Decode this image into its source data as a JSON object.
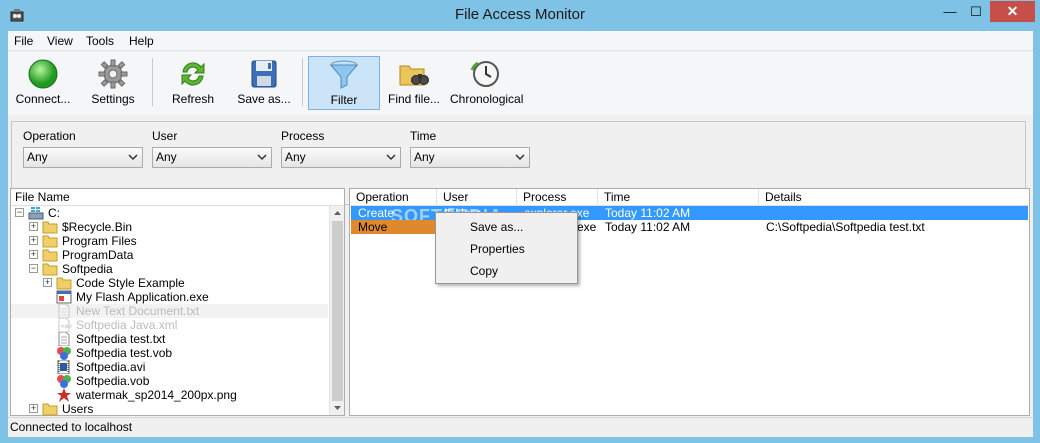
{
  "window": {
    "title": "File Access Monitor",
    "min_glyph": "—",
    "max_glyph": "☐",
    "close_glyph": "✕"
  },
  "menu": [
    "File",
    "View",
    "Tools",
    "Help"
  ],
  "toolbar": {
    "connect": "Connect...",
    "settings": "Settings",
    "refresh": "Refresh",
    "save_as": "Save as...",
    "filter": "Filter",
    "find_file": "Find file...",
    "chronological": "Chronological"
  },
  "filters": [
    {
      "label": "Operation",
      "value": "Any"
    },
    {
      "label": "User",
      "value": "Any"
    },
    {
      "label": "Process",
      "value": "Any"
    },
    {
      "label": "Time",
      "value": "Any"
    }
  ],
  "tree": {
    "header": "File Name",
    "nodes": [
      {
        "label": "C:",
        "icon": "drive-icon",
        "expander": "−"
      },
      {
        "label": "$Recycle.Bin",
        "icon": "folder-icon",
        "expander": "+"
      },
      {
        "label": "Program Files",
        "icon": "folder-icon",
        "expander": "+"
      },
      {
        "label": "ProgramData",
        "icon": "folder-icon",
        "expander": "+"
      },
      {
        "label": "Softpedia",
        "icon": "folder-icon",
        "expander": "−"
      },
      {
        "label": "Code Style Example",
        "icon": "folder-icon",
        "expander": "+"
      },
      {
        "label": "My Flash Application.exe",
        "icon": "exe-icon"
      },
      {
        "label": "New Text Document.txt",
        "icon": "text-file-icon",
        "dim": true
      },
      {
        "label": "Softpedia Java.xml",
        "icon": "xml-file-icon",
        "dim": true
      },
      {
        "label": "Softpedia test.txt",
        "icon": "text-file-icon"
      },
      {
        "label": "Softpedia test.vob",
        "icon": "media-file-icon"
      },
      {
        "label": "Softpedia.avi",
        "icon": "video-file-icon"
      },
      {
        "label": "Softpedia.vob",
        "icon": "media-file-icon"
      },
      {
        "label": "watermak_sp2014_200px.png",
        "icon": "image-file-icon"
      },
      {
        "label": "Users",
        "icon": "folder-icon",
        "expander": "+"
      }
    ]
  },
  "events": {
    "columns": [
      "Operation",
      "User",
      "Process",
      "Time",
      "Details"
    ],
    "rows": [
      {
        "operation": "Create",
        "user": "IEUser",
        "process": "explorer.exe",
        "time": "Today 11:02 AM",
        "details": ""
      },
      {
        "operation": "Move",
        "user": "",
        "process": "exe",
        "time": "Today 11:02 AM",
        "details": "C:\\Softpedia\\Softpedia test.txt"
      }
    ],
    "watermark": "SOFTPEDIA"
  },
  "context_menu": [
    "Save as...",
    "Properties",
    "Copy"
  ],
  "status": "Connected to localhost",
  "colors": {
    "titlebar": "#7ec3e6",
    "selection": "#3399ff",
    "move_highlight": "#e0892c",
    "close_button": "#c74f4a"
  }
}
